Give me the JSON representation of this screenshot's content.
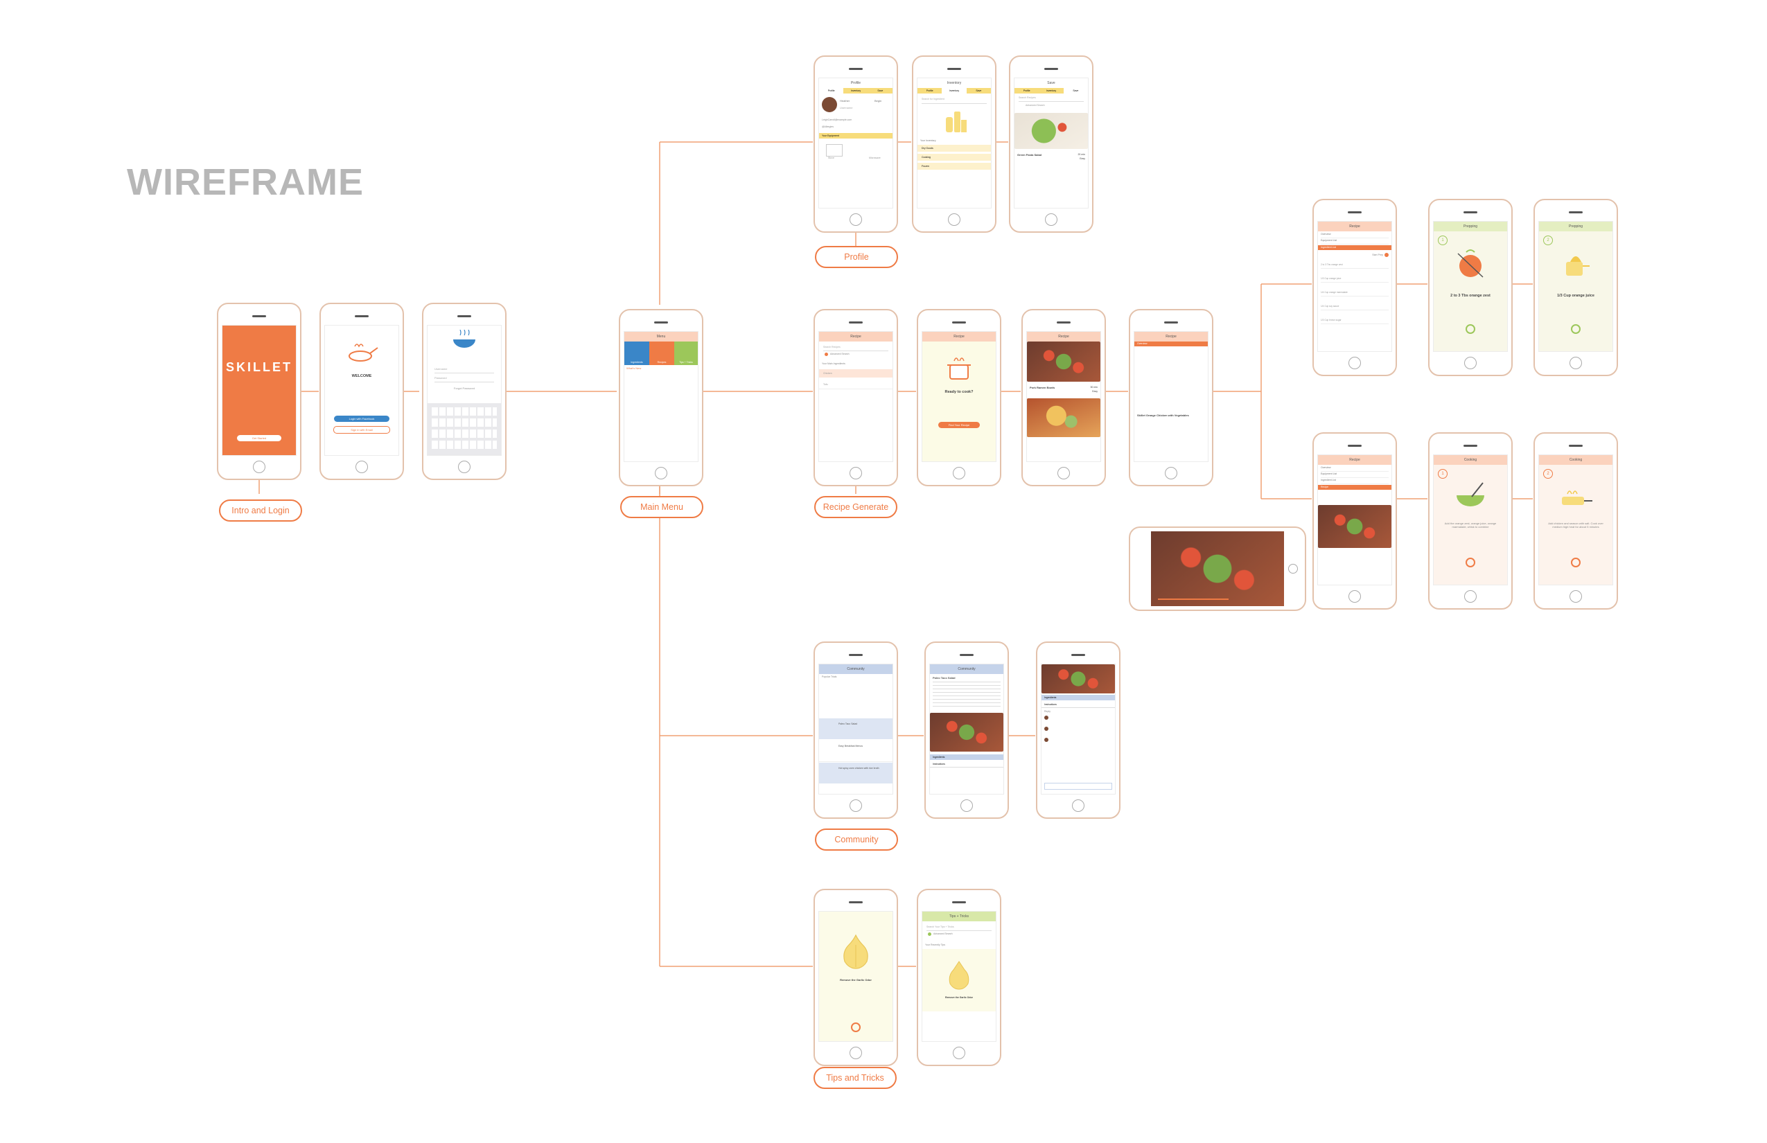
{
  "title": "WIREFRAME",
  "labels": {
    "intro": "Intro and Login",
    "main": "Main Menu",
    "profile": "Profile",
    "recipe": "Recipe Generate",
    "community": "Community",
    "tips": "Tips and Tricks"
  },
  "screens": {
    "splash_brand": "SKILLET",
    "splash_button": "Get Started",
    "welcome_title": "WELCOME",
    "login_fb": "Login with Facebook",
    "login_email": "Sign in with Email",
    "signup_username": "Username",
    "signup_password": "Password",
    "signup_forgot": "Forgot Password",
    "menu_header": "Menu",
    "menu_tiles": [
      "Ingredients",
      "Recipes",
      "Tips + Tricks"
    ],
    "menu_whats_new": "What's New",
    "profile_header": "Profile",
    "profile_tabs": [
      "Profile",
      "Inventory",
      "Save"
    ],
    "profile_name": "Heather",
    "profile_level": "Begin",
    "profile_username": "Username",
    "profile_email": "LeighCarroll@example.com",
    "profile_allergies": "@Allergies",
    "profile_equipment": "Your Equipment",
    "profile_equipment_items": [
      "Stove",
      "Microwave"
    ],
    "inventory_header": "Inventory",
    "inventory_search": "Search for Ingredient",
    "inventory_label": "Your Inventory",
    "inventory_items": [
      "Dry Goods",
      "Cooking",
      "Frozen"
    ],
    "save_header": "Save",
    "save_search": "Search Recipes",
    "save_advanced": "Advanced Search",
    "save_recipe_title": "Green Pasta Salad",
    "save_recipe_time": "20 min",
    "save_recipe_level": "Easy",
    "recipe_header": "Recipe",
    "recipe_search": "Search Recipes",
    "recipe_advanced": "Advanced Search",
    "recipe_main_ingredients": "Your Main Ingredients",
    "recipe_ingredient_items": [
      "Chicken",
      "Tofu"
    ],
    "ready_title": "Ready to cook?",
    "ready_button": "Find Your Recipe",
    "results_title": "Pork Ramen Bowls",
    "results_time": "30 min",
    "results_level": "Easy",
    "overview_tab": "Overview",
    "overview_title": "Skillet Orange Chicken with Vegetables",
    "detail_header": "Recipe",
    "detail_items": [
      "Overview",
      "Equipment List",
      "Ingredient List"
    ],
    "detail_start": "Start Prep",
    "detail_ingredients": [
      "2 to 3 Tbs orange zest",
      "1/3 Cup orange juice",
      "1/4 Cup orange marmalade",
      "1/4 Cup soy sauce",
      "1/3 Cup brown sugar"
    ],
    "detail2_items": [
      "Overview",
      "Equipment List",
      "Ingredient List",
      "Recipe"
    ],
    "prep_header": "Prepping",
    "prep_step1": "1",
    "prep_step1_text": "2 to 3 Tbs orange zest",
    "prep_step2": "2",
    "prep_step2_text": "1/3 Cup orange juice",
    "cook_header": "Cooking",
    "cook_step1": "1",
    "cook_step1_text": "Add the orange zest, orange juice, orange marmalade, whisk to combine",
    "cook_step2": "2",
    "cook_step2_text": "Add chicken and season with salt. Cook over medium high heat for about 5 minutes",
    "community_header": "Community",
    "community_popular": "Popular Trials",
    "community_posts": [
      "Paleo Taco Salad",
      "Easy Breakfast Menus",
      "Hot spicy oven chicken with rice broth"
    ],
    "post_title": "Paleo Taco Salad",
    "post_sections": [
      "Ingredients",
      "Instructions"
    ],
    "comments_label": "Reply",
    "tips_title": "Remove the Garlic Odor",
    "tips_header": "Tips + Tricks",
    "tips_search": "Search Your Tips + Tricks",
    "tips_advanced": "Advanced Search",
    "tips_recently": "Your Recently Tips"
  },
  "colors": {
    "accent": "#ef7b45",
    "line": "#f0a073",
    "title": "#b7b7b7",
    "peach": "#fbd2bd",
    "yellow": "#f7dc7b",
    "green": "#9cc75a",
    "blue": "#3a86c8",
    "community_blue": "#c5d3ea",
    "tips_green": "#d8e8a8"
  }
}
